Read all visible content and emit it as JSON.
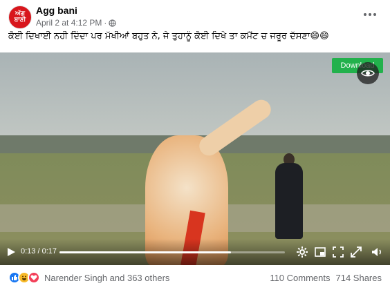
{
  "post": {
    "page_name": "Agg bani",
    "avatar_text": "ਅੱਗ ਬਾਣੀ",
    "timestamp": "April 2 at 4:12 PM",
    "separator": "·",
    "caption": "ਕੋਈ ਦਿਖਾਈ ਨਹੀ ਦਿੰਦਾ ਪਰ ਮੱਖੀਆਂ ਬਹੁਤ ਨੇ, ਜੇ ਤੁਹਾਨੂੰ ਕੋਈ ਦਿਖੇ ਤਾ ਕਮੈਂਟ ਚ ਜਰੂਰ ਦੱਸਣਾ😄😄",
    "privacy_icon": "globe-icon",
    "more_icon": "more-options-icon"
  },
  "video": {
    "download_label": "Download",
    "current_time": "0:13",
    "duration": "0:17",
    "time_label": "0:13 / 0:17",
    "progress": 0.76,
    "icons": [
      "play-icon",
      "settings-icon",
      "pip-icon",
      "fullscreen-icon",
      "volume-icon",
      "eye-icon"
    ]
  },
  "footer": {
    "reaction_icons": [
      "like-icon",
      "haha-icon",
      "love-icon"
    ],
    "reaction_names": "Narender Singh and 363 others",
    "comments": "110 Comments",
    "shares": "714 Shares"
  },
  "colors": {
    "download": "#22b14c",
    "like": "#1877f2",
    "haha": "#f7b928",
    "love": "#f33e58",
    "avatar": "#d8161c"
  }
}
